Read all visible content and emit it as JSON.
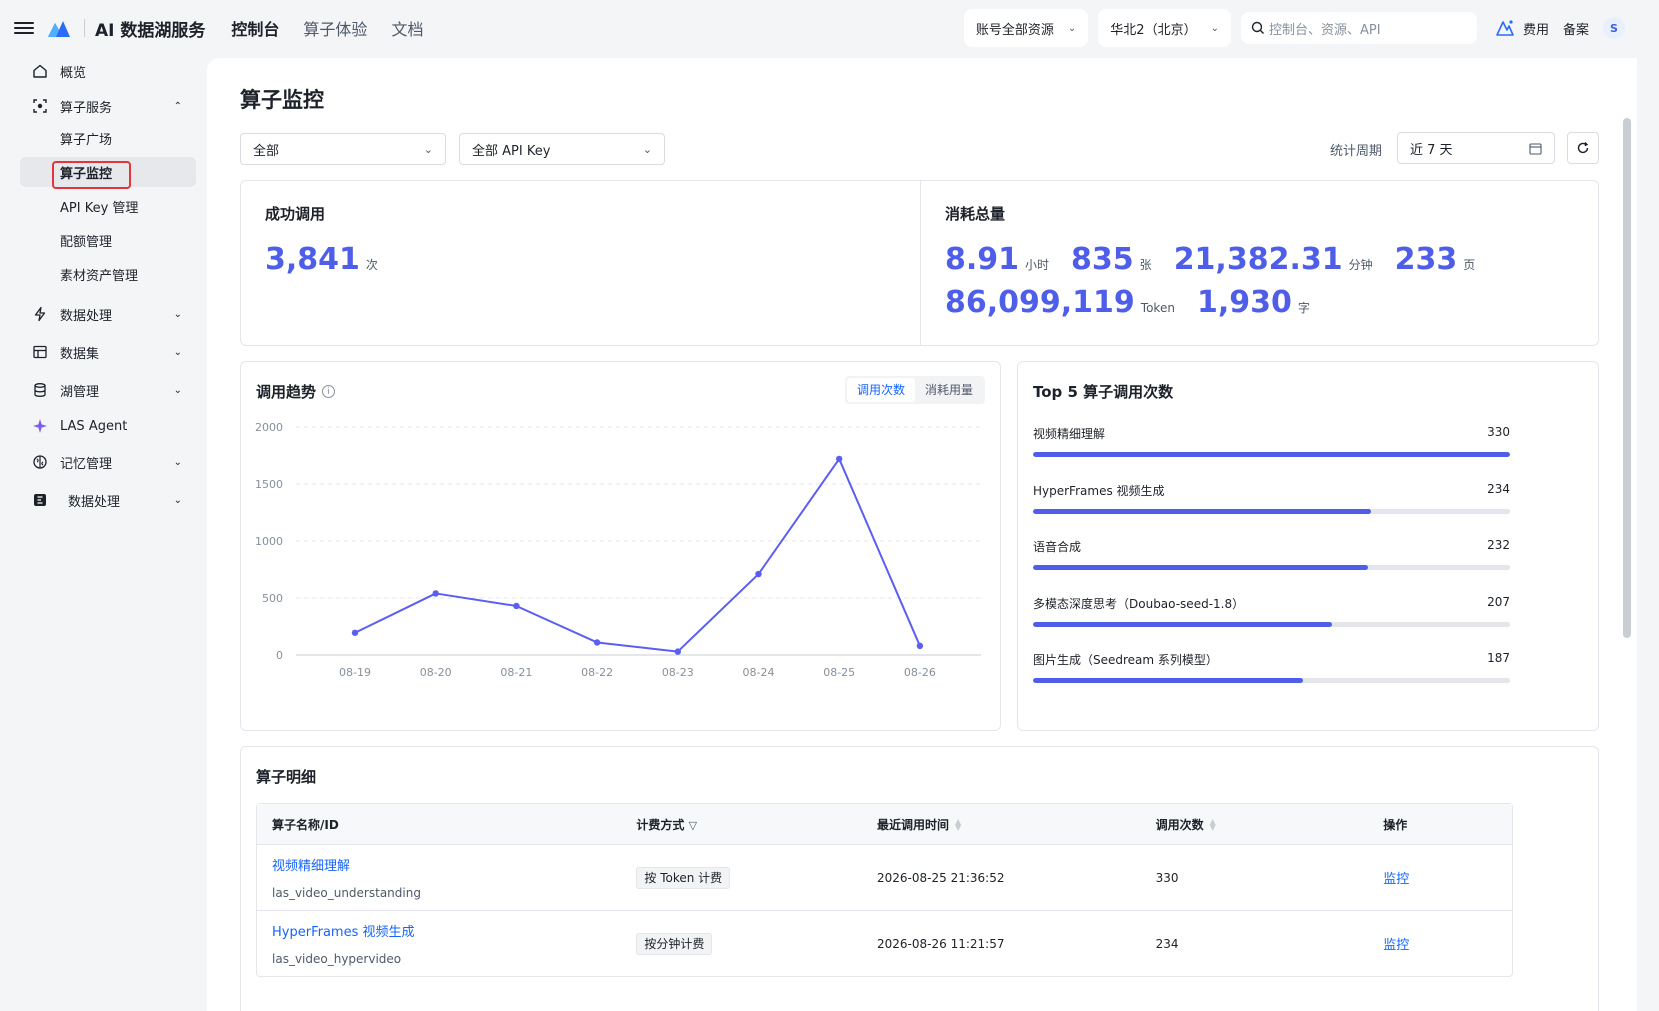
{
  "header": {
    "app_title": "AI 数据湖服务",
    "nav": [
      "控制台",
      "算子体验",
      "文档"
    ],
    "account_scope": "账号全部资源",
    "region": "华北2（北京）",
    "search_placeholder": "控制台、资源、API",
    "billing": "费用",
    "filing": "备案",
    "avatar": "S"
  },
  "sidebar": {
    "overview": "概览",
    "operator_service": "算子服务",
    "sub": [
      "算子广场",
      "算子监控",
      "API Key 管理",
      "配额管理",
      "素材资产管理"
    ],
    "data_processing": "数据处理",
    "dataset": "数据集",
    "lake_mgmt": "湖管理",
    "las_agent": "LAS Agent",
    "memory_mgmt": "记忆管理",
    "data_processing2": "数据处理"
  },
  "page": {
    "title": "算子监控",
    "filter_all": "全部",
    "filter_apikey": "全部 API Key",
    "period_label": "统计周期",
    "period_value": "近 7 天"
  },
  "stats": {
    "success_title": "成功调用",
    "success_value": "3,841",
    "success_unit": "次",
    "consume_title": "消耗总量",
    "consume": [
      {
        "value": "8.91",
        "unit": "小时"
      },
      {
        "value": "835",
        "unit": "张"
      },
      {
        "value": "21,382.31",
        "unit": "分钟"
      },
      {
        "value": "233",
        "unit": "页"
      },
      {
        "value": "86,099,119",
        "unit": "Token"
      },
      {
        "value": "1,930",
        "unit": "字"
      }
    ]
  },
  "trend": {
    "title": "调用趋势",
    "tab_calls": "调用次数",
    "tab_usage": "消耗用量"
  },
  "chart_data": {
    "type": "line",
    "x": [
      "08-19",
      "08-20",
      "08-21",
      "08-22",
      "08-23",
      "08-24",
      "08-25",
      "08-26"
    ],
    "series": [
      {
        "values": [
          195,
          540,
          430,
          110,
          30,
          710,
          1720,
          80
        ]
      }
    ],
    "ylim": [
      0,
      2000
    ],
    "yticks": [
      0,
      500,
      1000,
      1500,
      2000
    ],
    "grid": true,
    "color": "#5b5ef0"
  },
  "top5": {
    "title": "Top 5 算子调用次数",
    "max": 330,
    "items": [
      {
        "name": "视频精细理解",
        "value": 330
      },
      {
        "name": "HyperFrames 视频生成",
        "value": 234
      },
      {
        "name": "语音合成",
        "value": 232
      },
      {
        "name": "多模态深度思考（Doubao-seed-1.8）",
        "value": 207
      },
      {
        "name": "图片生成（Seedream 系列模型）",
        "value": 187
      }
    ]
  },
  "detail": {
    "title": "算子明细",
    "columns": [
      "算子名称/ID",
      "计费方式",
      "最近调用时间",
      "调用次数",
      "操作"
    ],
    "rows": [
      {
        "name": "视频精细理解",
        "id": "las_video_understanding",
        "billing": "按 Token 计费",
        "last_call": "2026-08-25 21:36:52",
        "count": "330",
        "action": "监控"
      },
      {
        "name": "HyperFrames 视频生成",
        "id": "las_video_hypervideo",
        "billing": "按分钟计费",
        "last_call": "2026-08-26 11:21:57",
        "count": "234",
        "action": "监控"
      }
    ]
  },
  "colors": {
    "accent": "#4f5ee8",
    "link": "#1664ff",
    "highlight": "#e5343a"
  }
}
